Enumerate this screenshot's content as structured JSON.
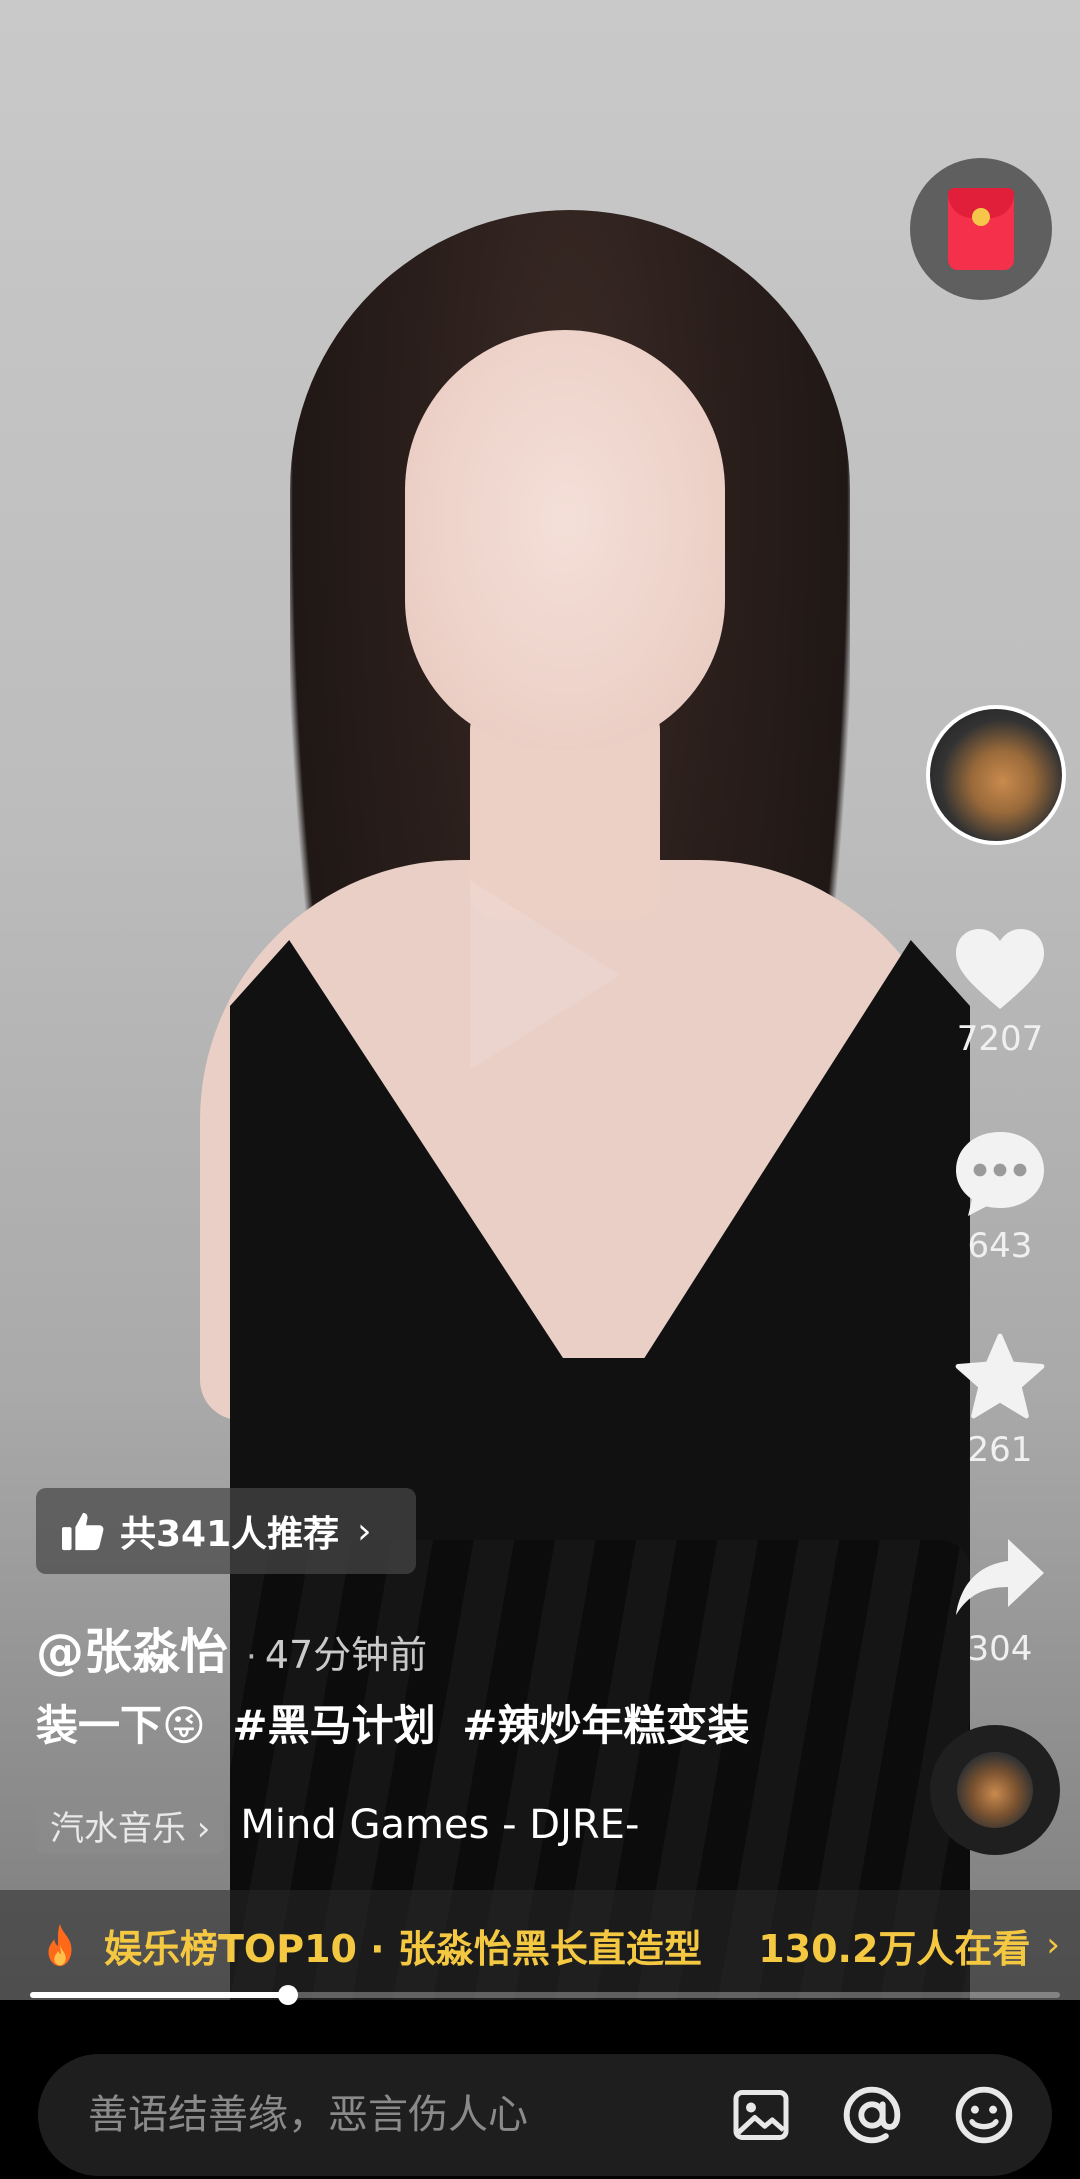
{
  "rail": {
    "likes": "7207",
    "comments": "643",
    "favorites": "261",
    "shares": "304"
  },
  "recommend": {
    "label": "共341人推荐",
    "chevron": "›"
  },
  "post": {
    "author": "@张淼怡",
    "separator": "·",
    "time": "47分钟前",
    "caption_text": "装一下😜",
    "hashtag1": "#黑马计划",
    "hashtag2": "#辣炒年糕变装"
  },
  "music": {
    "tag": "汽水音乐 ›",
    "name": "Mind Games - DJRE-"
  },
  "hot": {
    "title": "娱乐榜TOP10 · 张淼怡黑长直造型",
    "watching": "130.2万人在看",
    "chevron": "›"
  },
  "playback": {
    "progress": 0.25
  },
  "comment_bar": {
    "placeholder": "善语结善缘，恶言伤人心"
  },
  "colors": {
    "accent_yellow": "#f5c842",
    "red_packet": "#f4304a"
  },
  "icons": [
    "red-packet-icon",
    "heart-icon",
    "comment-icon",
    "star-icon",
    "share-icon",
    "thumbs-up-icon",
    "fire-icon",
    "image-icon",
    "at-icon",
    "emoji-icon"
  ]
}
